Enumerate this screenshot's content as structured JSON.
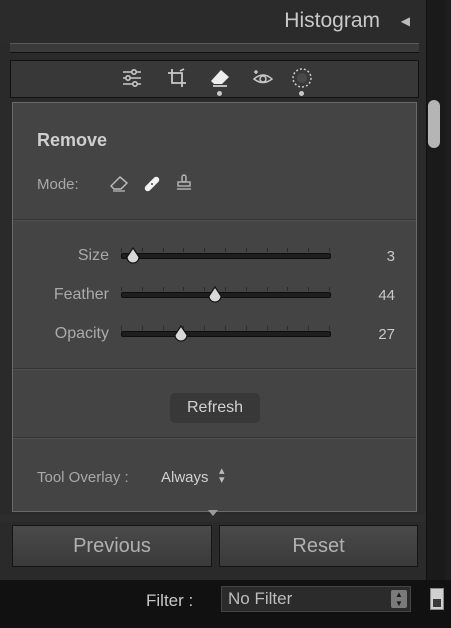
{
  "header": {
    "title": "Histogram",
    "collapse_glyph": "◀"
  },
  "toolbar": {
    "tools": [
      {
        "icon": "edit-sliders-icon",
        "dot": false
      },
      {
        "icon": "crop-icon",
        "dot": false
      },
      {
        "icon": "eraser-icon",
        "dot": true,
        "active": true
      },
      {
        "icon": "redeye-icon",
        "dot": false
      },
      {
        "icon": "mask-icon",
        "dot": true
      }
    ]
  },
  "remove_panel": {
    "title": "Remove",
    "mode_label": "Mode:",
    "modes": [
      "eraser-icon",
      "bandage-icon",
      "stamp-icon"
    ],
    "sliders": [
      {
        "label": "Size",
        "value": "3",
        "fraction": 0.06
      },
      {
        "label": "Feather",
        "value": "44",
        "fraction": 0.45
      },
      {
        "label": "Opacity",
        "value": "27",
        "fraction": 0.29
      }
    ],
    "refresh_label": "Refresh",
    "tool_overlay_label": "Tool Overlay :",
    "tool_overlay_value": "Always"
  },
  "buttons": {
    "previous": "Previous",
    "reset": "Reset"
  },
  "filter": {
    "label": "Filter :",
    "value": "No Filter"
  }
}
